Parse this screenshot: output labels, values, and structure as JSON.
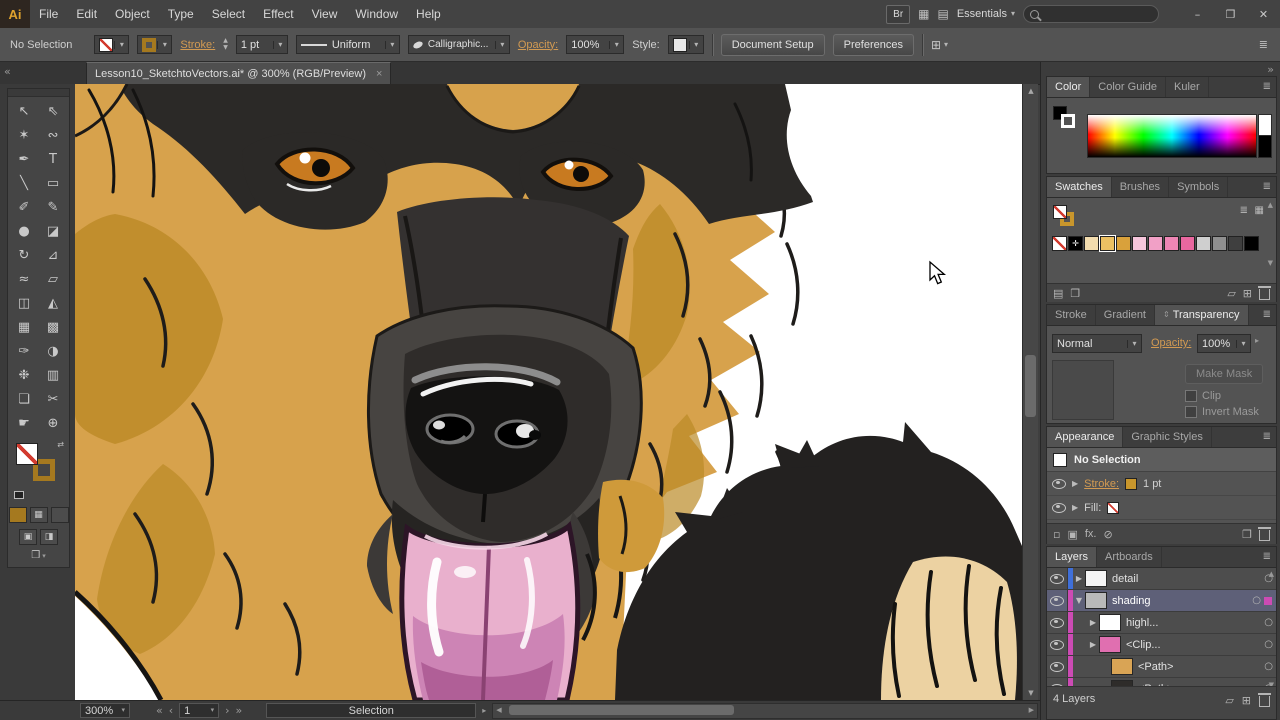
{
  "icons": {
    "caret": "▾",
    "caret_right": "▸",
    "arrow_up": "▲",
    "arrow_down": "▼",
    "arrow_left": "◀",
    "arrow_right": "▶",
    "panel_menu": "≣",
    "target_circle": "○",
    "list_view": "≣",
    "grid_view": "▦",
    "swap": "⇄",
    "cycle": "⇕",
    "collapse_left": "«",
    "collapse_right": "»",
    "library": "▤",
    "folder": "▱",
    "new_item": "⊞",
    "sub_options": "◨",
    "screen_mode": "❒",
    "draw_normal": "▣",
    "registration": "✛",
    "duplicate": "❐",
    "disc": "⊘",
    "square": "▫",
    "filled_square": "▣",
    "minimize": "–",
    "restore": "❐",
    "close": "✕",
    "arrange": "▤",
    "grid": "▦"
  },
  "menubar": {
    "logo": "Ai",
    "items": [
      "File",
      "Edit",
      "Object",
      "Type",
      "Select",
      "Effect",
      "View",
      "Window",
      "Help"
    ],
    "bridge": "Br",
    "workspace": "Essentials"
  },
  "controlbar": {
    "no_selection": "No Selection",
    "stroke_label": "Stroke:",
    "stroke_value": "1 pt",
    "profile_value": "Uniform",
    "brush_value": "Calligraphic...",
    "opacity_label": "Opacity:",
    "opacity_value": "100%",
    "style_label": "Style:",
    "document_setup": "Document Setup",
    "preferences": "Preferences"
  },
  "document_tab": {
    "title": "Lesson10_SketchtoVectors.ai* @ 300% (RGB/Preview)",
    "close": "×"
  },
  "tools": [
    {
      "name": "selection",
      "glyph": "↖"
    },
    {
      "name": "direct-selection",
      "glyph": "⇖"
    },
    {
      "name": "magic-wand",
      "glyph": "✶"
    },
    {
      "name": "lasso",
      "glyph": "∾"
    },
    {
      "name": "pen",
      "glyph": "✒"
    },
    {
      "name": "type",
      "glyph": "T"
    },
    {
      "name": "line-segment",
      "glyph": "╲"
    },
    {
      "name": "rectangle",
      "glyph": "▭"
    },
    {
      "name": "paintbrush",
      "glyph": "✐"
    },
    {
      "name": "pencil",
      "glyph": "✎"
    },
    {
      "name": "blob-brush",
      "glyph": "●"
    },
    {
      "name": "eraser",
      "glyph": "◪"
    },
    {
      "name": "rotate",
      "glyph": "↻"
    },
    {
      "name": "scale",
      "glyph": "⊿"
    },
    {
      "name": "width",
      "glyph": "≈"
    },
    {
      "name": "free-transform",
      "glyph": "▱"
    },
    {
      "name": "shape-builder",
      "glyph": "◫"
    },
    {
      "name": "perspective-grid",
      "glyph": "◭"
    },
    {
      "name": "mesh",
      "glyph": "▦"
    },
    {
      "name": "gradient",
      "glyph": "▩"
    },
    {
      "name": "eyedropper",
      "glyph": "✑"
    },
    {
      "name": "blend",
      "glyph": "◑"
    },
    {
      "name": "symbol-sprayer",
      "glyph": "❉"
    },
    {
      "name": "column-graph",
      "glyph": "▥"
    },
    {
      "name": "artboard",
      "glyph": "❏"
    },
    {
      "name": "slice",
      "glyph": "✂"
    },
    {
      "name": "hand",
      "glyph": "☛"
    },
    {
      "name": "zoom",
      "glyph": "⊕"
    }
  ],
  "statusbar": {
    "zoom": "300%",
    "artboard": "1",
    "status": "Selection",
    "first": "«",
    "prev": "‹",
    "next": "›",
    "last": "»"
  },
  "panels": {
    "color": {
      "tabs": [
        "Color",
        "Color Guide",
        "Kuler"
      ]
    },
    "swatches": {
      "tabs": [
        "Swatches",
        "Brushes",
        "Symbols"
      ],
      "colors": [
        "#F2DCAE",
        "#EBC063",
        "#D9A13B",
        "#F6C6DC",
        "#F1A0C6",
        "#EE86B5",
        "#E9679F",
        "#CFCFCF",
        "#8F8F8F",
        "#3F3F3F",
        "#000000"
      ]
    },
    "transparency": {
      "tabs": [
        "Stroke",
        "Gradient",
        "Transparency"
      ],
      "blend_mode": "Normal",
      "opacity_label": "Opacity:",
      "opacity_value": "100%",
      "make_mask": "Make Mask",
      "clip": "Clip",
      "invert_mask": "Invert Mask"
    },
    "appearance": {
      "tabs": [
        "Appearance",
        "Graphic Styles"
      ],
      "no_selection": "No Selection",
      "stroke_label": "Stroke:",
      "stroke_value": "1 pt",
      "fill_label": "Fill:",
      "fx": "fx."
    },
    "layers": {
      "tabs": [
        "Layers",
        "Artboards"
      ],
      "footer": "4 Layers",
      "rows": [
        {
          "label": "detail",
          "layer_color": "#3f6fd8",
          "thumb_color": "#f4f4f4",
          "arrow": "▶",
          "selected": false
        },
        {
          "label": "shading",
          "layer_color": "#cc4bb4",
          "thumb_color": "#b9b9b9",
          "arrow": "▼",
          "selected": true
        },
        {
          "label": "highl...",
          "layer_color": "#cc4bb4",
          "thumb_color": "#ffffff",
          "arrow": "▶",
          "selected": false
        },
        {
          "label": "<Clip...",
          "layer_color": "#cc4bb4",
          "thumb_color": "#e06fb0",
          "arrow": "▶",
          "selected": false
        },
        {
          "label": "<Path>",
          "layer_color": "#cc4bb4",
          "thumb_color": "#d9a455",
          "arrow": "",
          "selected": false
        },
        {
          "label": "<Path>",
          "layer_color": "#cc4bb4",
          "thumb_color": "#2e2c2a",
          "arrow": "",
          "selected": false
        }
      ]
    }
  },
  "colors": {
    "selection_highlight": "#5e6078",
    "label_accent": "#d29a52"
  }
}
